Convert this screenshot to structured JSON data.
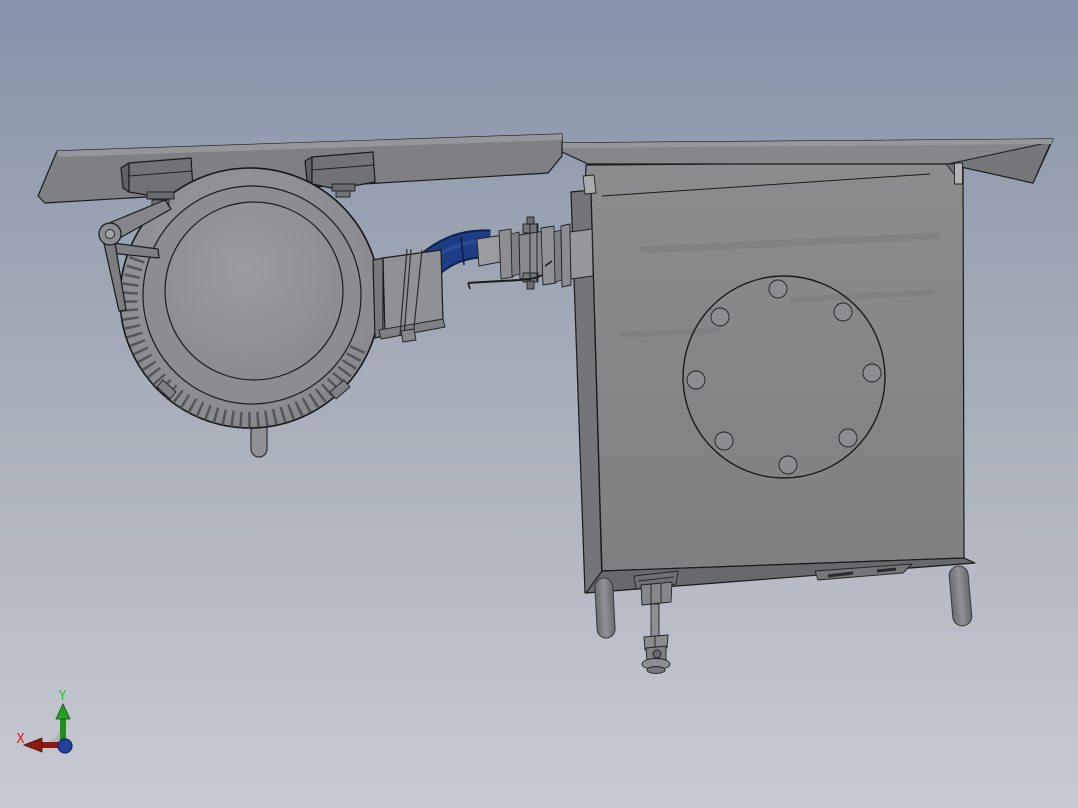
{
  "scene": {
    "model_parts": [
      "top-mounting-plate-left",
      "top-mounting-plate-right",
      "mounting-blocks",
      "blower-housing",
      "support-bracket",
      "air-duct-box",
      "elbow-hose",
      "pipe-clamp-coupling",
      "tank-body",
      "tank-access-flange",
      "tank-legs",
      "drain-valve"
    ]
  },
  "triad": {
    "x_label": "X",
    "y_label": "Y",
    "x_label_color": "#e31313",
    "y_label_color": "#21cd21",
    "x_axis_color": "#8b1a12",
    "x_axis_edge": "#4f0c08",
    "y_axis_color": "#1f8c1c",
    "y_axis_head": "#28a024",
    "y_axis_edge": "#0c4d0c",
    "z_axis_color": "#24409f",
    "z_axis_edge": "#15275f",
    "sector_color": "#afb2b7"
  },
  "colors": {
    "background_top": "#8693a8",
    "background_mid": "#a9afba",
    "background_bottom": "#c7cad2",
    "steel_light": "#97999c",
    "steel_mid": "#868889",
    "steel_dark": "#6e7073",
    "steel_darker": "#5d5f62",
    "edge_outline": "#1a1a1a",
    "hose_blue": "#1e3d85",
    "hose_blue_dark": "#10224a"
  }
}
